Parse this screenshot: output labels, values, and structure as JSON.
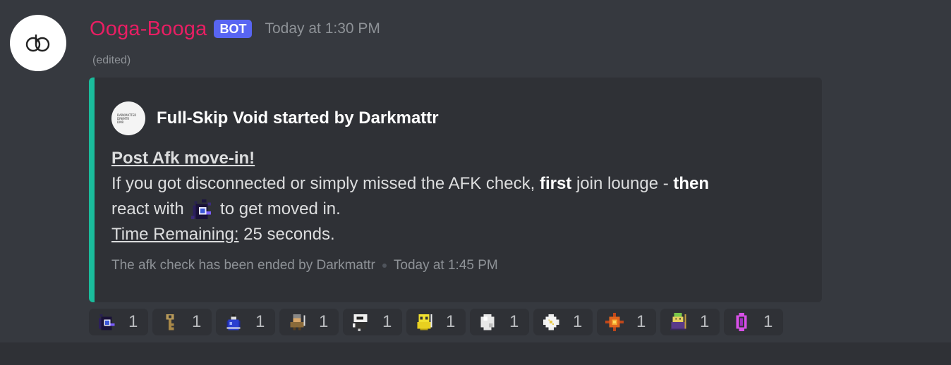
{
  "message": {
    "username": "Ooga-Booga",
    "bot_tag": "BOT",
    "timestamp": "Today at 1:30 PM",
    "edited": "(edited)",
    "avatar_icon": "ob-logo-icon",
    "name_color": "#e91e63"
  },
  "embed": {
    "accent_color": "#1abc9c",
    "author_icon_text": [
      "DARKMATTER",
      "DRKMTR",
      "DMR"
    ],
    "author_name": "Full-Skip Void started by Darkmattr",
    "title": "Post Afk move-in!",
    "line1_pre": "If you got disconnected or simply missed the AFK check, ",
    "line1_bold1": "first",
    "line1_mid": " join lounge - ",
    "line1_bold2": "then",
    "line2_pre": "react with",
    "line2_post": "to get moved in.",
    "time_label": "Time Remaining:",
    "time_value": " 25 seconds.",
    "footer_text": "The afk check has been ended by Darkmattr",
    "footer_time": "Today at 1:45 PM"
  },
  "reactions": [
    {
      "icon": "void-portal-icon",
      "count": "1"
    },
    {
      "icon": "key-icon",
      "count": "1"
    },
    {
      "icon": "potion-icon",
      "count": "1"
    },
    {
      "icon": "warrior-icon",
      "count": "1"
    },
    {
      "icon": "knight-icon",
      "count": "1"
    },
    {
      "icon": "priest-icon",
      "count": "1"
    },
    {
      "icon": "orb-icon",
      "count": "1"
    },
    {
      "icon": "star-gem-icon",
      "count": "1"
    },
    {
      "icon": "fire-gem-icon",
      "count": "1"
    },
    {
      "icon": "mystic-icon",
      "count": "1"
    },
    {
      "icon": "crystal-icon",
      "count": "1"
    }
  ]
}
